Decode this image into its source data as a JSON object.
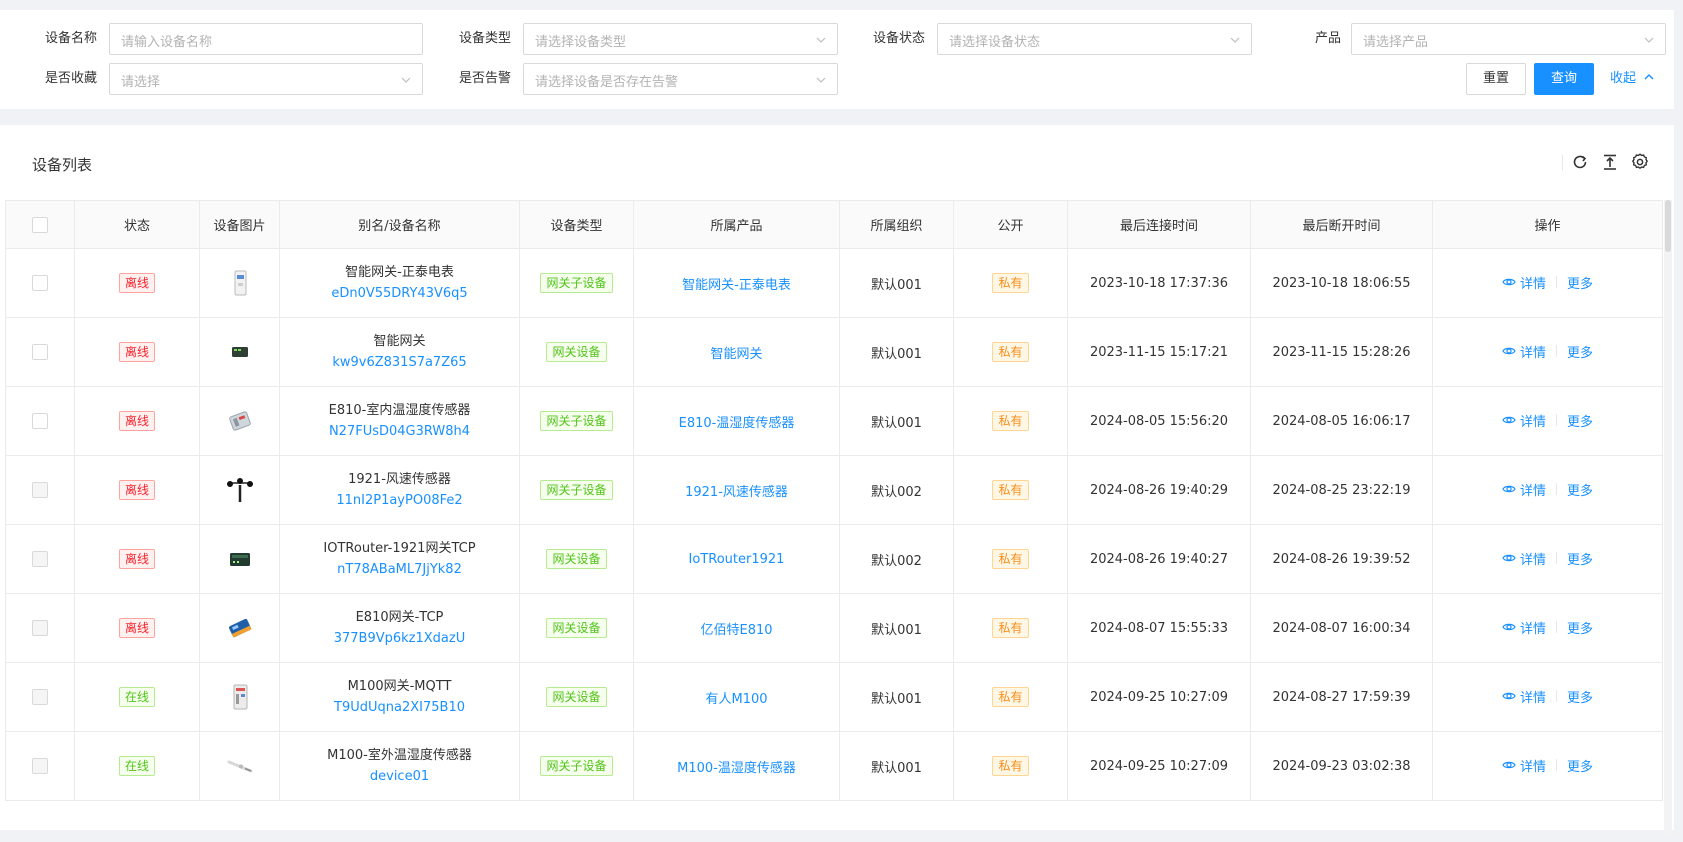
{
  "filters": {
    "device_name": {
      "label": "设备名称",
      "placeholder": "请输入设备名称"
    },
    "device_type": {
      "label": "设备类型",
      "placeholder": "请选择设备类型"
    },
    "device_status": {
      "label": "设备状态",
      "placeholder": "请选择设备状态"
    },
    "product": {
      "label": "产品",
      "placeholder": "请选择产品"
    },
    "favorite": {
      "label": "是否收藏",
      "placeholder": "请选择"
    },
    "alarm": {
      "label": "是否告警",
      "placeholder": "请选择设备是否存在告警"
    },
    "reset_label": "重置",
    "query_label": "查询",
    "collapse_label": "收起"
  },
  "table": {
    "title": "设备列表",
    "columns": [
      "状态",
      "设备图片",
      "别名/设备名称",
      "设备类型",
      "所属产品",
      "所属组织",
      "公开",
      "最后连接时间",
      "最后断开时间",
      "操作"
    ],
    "detail_label": "详情",
    "more_label": "更多",
    "rows": [
      {
        "status": "离线",
        "status_kind": "offline",
        "image": "meter",
        "alias": "智能网关-正泰电表",
        "sn": "eDn0V55DRY43V6q5",
        "type": "网关子设备",
        "product": "智能网关-正泰电表",
        "org": "默认001",
        "public": "私有",
        "last_connect": "2023-10-18 17:37:36",
        "last_disconnect": "2023-10-18 18:06:55"
      },
      {
        "status": "离线",
        "status_kind": "offline",
        "image": "gateway-small",
        "alias": "智能网关",
        "sn": "kw9v6Z831S7a7Z65",
        "type": "网关设备",
        "product": "智能网关",
        "org": "默认001",
        "public": "私有",
        "last_connect": "2023-11-15 15:17:21",
        "last_disconnect": "2023-11-15 15:28:26"
      },
      {
        "status": "离线",
        "status_kind": "offline",
        "image": "sensor-box",
        "alias": "E810-室内温湿度传感器",
        "sn": "N27FUsD04G3RW8h4",
        "type": "网关子设备",
        "product": "E810-温湿度传感器",
        "org": "默认001",
        "public": "私有",
        "last_connect": "2024-08-05 15:56:20",
        "last_disconnect": "2024-08-05 16:06:17"
      },
      {
        "status": "离线",
        "status_kind": "offline",
        "image": "anemometer",
        "alias": "1921-风速传感器",
        "sn": "11nI2P1ayPO08Fe2",
        "type": "网关子设备",
        "product": "1921-风速传感器",
        "org": "默认002",
        "public": "私有",
        "last_connect": "2024-08-26 19:40:29",
        "last_disconnect": "2024-08-25 23:22:19"
      },
      {
        "status": "离线",
        "status_kind": "offline",
        "image": "router",
        "alias": "IOTRouter-1921网关TCP",
        "sn": "nT78ABaML7JjYk82",
        "type": "网关设备",
        "product": "IoTRouter1921",
        "org": "默认002",
        "public": "私有",
        "last_connect": "2024-08-26 19:40:27",
        "last_disconnect": "2024-08-26 19:39:52"
      },
      {
        "status": "离线",
        "status_kind": "offline",
        "image": "e810-gateway",
        "alias": "E810网关-TCP",
        "sn": "377B9Vp6kz1XdazU",
        "type": "网关设备",
        "product": "亿佰特E810",
        "org": "默认001",
        "public": "私有",
        "last_connect": "2024-08-07 15:55:33",
        "last_disconnect": "2024-08-07 16:00:34"
      },
      {
        "status": "在线",
        "status_kind": "online",
        "image": "m100",
        "alias": "M100网关-MQTT",
        "sn": "T9UdUqna2XI75B10",
        "type": "网关设备",
        "product": "有人M100",
        "org": "默认001",
        "public": "私有",
        "last_connect": "2024-09-25 10:27:09",
        "last_disconnect": "2024-08-27 17:59:39"
      },
      {
        "status": "在线",
        "status_kind": "online",
        "image": "probe",
        "alias": "M100-室外温湿度传感器",
        "sn": "device01",
        "type": "网关子设备",
        "product": "M100-温湿度传感器",
        "org": "默认001",
        "public": "私有",
        "last_connect": "2024-09-25 10:27:09",
        "last_disconnect": "2024-09-23 03:02:38"
      }
    ]
  },
  "colors": {
    "accent": "#1890ff",
    "offline": "#f5222d",
    "online": "#52c41a",
    "private": "#fa8c16"
  },
  "icons": [
    "chevron-down-icon",
    "chevron-up-icon",
    "refresh-icon",
    "export-icon",
    "settings-icon",
    "eye-icon"
  ]
}
